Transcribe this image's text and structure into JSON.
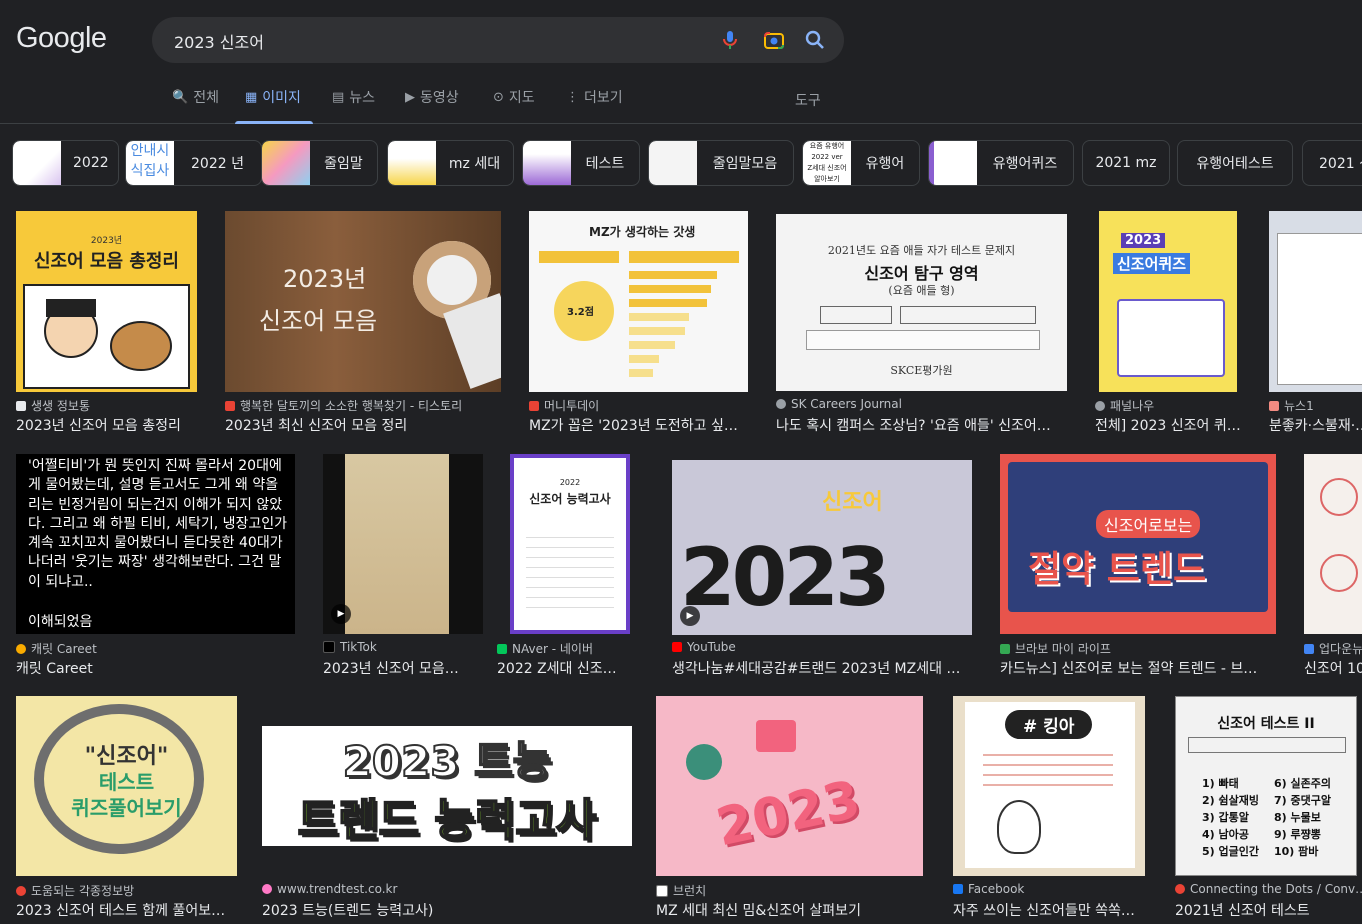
{
  "logo": "Google",
  "search": {
    "query": "2023 신조어"
  },
  "tabs": [
    {
      "icon": "🔍",
      "label": "전체",
      "active": false
    },
    {
      "icon": "▦",
      "label": "이미지",
      "active": true
    },
    {
      "icon": "▤",
      "label": "뉴스",
      "active": false
    },
    {
      "icon": "▶",
      "label": "동영상",
      "active": false
    },
    {
      "icon": "⊙",
      "label": "지도",
      "active": false
    },
    {
      "icon": "⋮",
      "label": "더보기",
      "active": false
    }
  ],
  "tools": "도구",
  "chips": [
    {
      "label": "2022"
    },
    {
      "label": "2022 년"
    },
    {
      "label": "줄임말"
    },
    {
      "label": "mz 세대"
    },
    {
      "label": "테스트"
    },
    {
      "label": "줄임말모음"
    },
    {
      "label": "유행어"
    },
    {
      "label": "유행어퀴즈"
    },
    {
      "label": "2021 mz"
    },
    {
      "label": "유행어테스트"
    },
    {
      "label": "2021 신"
    }
  ],
  "results": [
    {
      "source": "생생 정보통",
      "title": "2023년 신조어 모음 총정리",
      "img_text": [
        "2023년",
        "신조어 모음 총정리"
      ]
    },
    {
      "source": "행복한 달토끼의 소소한 행복찾기 - 티스토리",
      "title": "2023년 최신 신조어 모음 정리",
      "img_text": [
        "2023년",
        "신조어 모음"
      ]
    },
    {
      "source": "머니투데이",
      "title": "MZ가 꼽은 '2023년 도전하고 싶…",
      "img_text": [
        "MZ가 생각하는 갓생",
        "3.2점"
      ]
    },
    {
      "source": "SK Careers Journal",
      "title": "나도 혹시 캠퍼스 조상님? '요즘 애들' 신조어…",
      "img_text": [
        "2021년도 요즘 애들 자가 테스트 문제지",
        "신조어 탐구 영역",
        "(요즘 애들 형)",
        "SKCE평가원"
      ]
    },
    {
      "source": "패널나우",
      "title": "전체] 2023 신조어 퀴…",
      "img_text": [
        "2023",
        "신조어퀴즈"
      ]
    },
    {
      "source": "뉴스1",
      "title": "분좋카·스불재·…",
      "img_text": []
    },
    {
      "source": "캐릿 Careet",
      "title": "캐릿 Careet",
      "img_text": [
        "'어쩔티비'가 뭔 뜻인지 진짜 몰라서 20대에게 물어봤는데, 설명 듣고서도 그게 왜 약올리는 빈정거림이 되는건지 이해가 되지 않았다. 그리고 왜 하필 티비, 세탁기, 냉장고인가 계속 꼬치꼬치 물어봤더니 듣다못한 40대가 나더러 '웃기는 짜장' 생각해보란다. 그건 말이 되냐고..",
        "이해되었음"
      ]
    },
    {
      "source": "TikTok",
      "title": "2023년 신조어 모음…",
      "img_text": []
    },
    {
      "source": "NAver - 네이버",
      "title": "2022 Z세대 신조어 …",
      "img_text": [
        "2022",
        "신조어 능력고사"
      ]
    },
    {
      "source": "YouTube",
      "title": "생각나눔#세대공감#트랜드 2023년 MZ세대 …",
      "img_text": [
        "신조어",
        "2023"
      ]
    },
    {
      "source": "브라보 마이 라이프",
      "title": "카드뉴스] 신조어로 보는 절약 트렌드 - 브…",
      "img_text": [
        "신조어로보는",
        "절약 트렌드"
      ]
    },
    {
      "source": "업다운뉴",
      "title": "신조어 10",
      "img_text": []
    },
    {
      "source": "도움되는 각종정보방",
      "title": "2023 신조어 테스트 함께 풀어보…",
      "img_text": [
        "\"신조어\"",
        "테스트",
        "퀴즈풀어보기"
      ]
    },
    {
      "source": "www.trendtest.co.kr",
      "title": "2023 트능(트렌드 능력고사)",
      "img_text": [
        "2023 트능",
        "트렌드 능력고사"
      ]
    },
    {
      "source": "브런치",
      "title": "MZ 세대 최신 밈&신조어 살펴보기",
      "img_text": [
        "2023"
      ]
    },
    {
      "source": "Facebook",
      "title": "자주 쓰이는 신조어들만 쏙쏙…",
      "img_text": [
        "# 킹아"
      ]
    },
    {
      "source": "Connecting the Dots / Conv…",
      "title": "2021년 신조어 테스트",
      "img_text": [
        "신조어 테스트 II",
        "1) 빠태",
        "2) 쉼살재빙",
        "3) 갑통알",
        "4) 남아공",
        "5) 업글인간",
        "6) 실존주의",
        "7) 중댓구알",
        "8) 누물보",
        "9) 루쨩뽕",
        "10) 팜바"
      ]
    }
  ]
}
